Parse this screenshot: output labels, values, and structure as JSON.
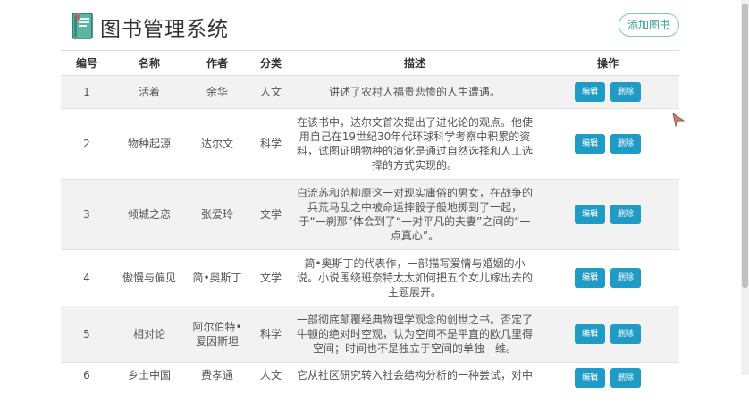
{
  "header": {
    "title": "图书管理系统",
    "add_button_label": "添加图书",
    "icon": "book-icon"
  },
  "table": {
    "columns": [
      "编号",
      "名称",
      "作者",
      "分类",
      "描述",
      "操作"
    ],
    "edit_label": "编辑",
    "delete_label": "删除",
    "rows": [
      {
        "id": "1",
        "name": "活着",
        "author": "余华",
        "category": "人文",
        "desc": "讲述了农村人福贵悲惨的人生遭遇。"
      },
      {
        "id": "2",
        "name": "物种起源",
        "author": "达尔文",
        "category": "科学",
        "desc": "在该书中，达尔文首次提出了进化论的观点。他使用自己在19世纪30年代环球科学考察中积累的资料，试图证明物种的演化是通过自然选择和人工选择的方式实现的。"
      },
      {
        "id": "3",
        "name": "倾城之恋",
        "author": "张爱玲",
        "category": "文学",
        "desc": "白流苏和范柳原这一对现实庸俗的男女，在战争的兵荒马乱之中被命运摔骰子般地掷到了一起，于“一刹那”体会到了“一对平凡的夫妻”之间的“一点真心”。"
      },
      {
        "id": "4",
        "name": "傲慢与偏见",
        "author": "简•奥斯丁",
        "category": "文学",
        "desc": "简•奥斯丁的代表作，一部描写爱情与婚姻的小说。小说围绕班奈特太太如何把五个女儿嫁出去的主题展开。"
      },
      {
        "id": "5",
        "name": "相对论",
        "author": "阿尔伯特•爱因斯坦",
        "category": "科学",
        "desc": "一部彻底颠覆经典物理学观念的创世之书。否定了牛顿的绝对时空观，认为空间不是平直的欧几里得空间；时间也不是独立于空间的单独一维。"
      },
      {
        "id": "6",
        "name": "乡土中国",
        "author": "费孝通",
        "category": "人文",
        "desc": "它从社区研究转入社会结构分析的一种尝试，对中"
      }
    ]
  }
}
